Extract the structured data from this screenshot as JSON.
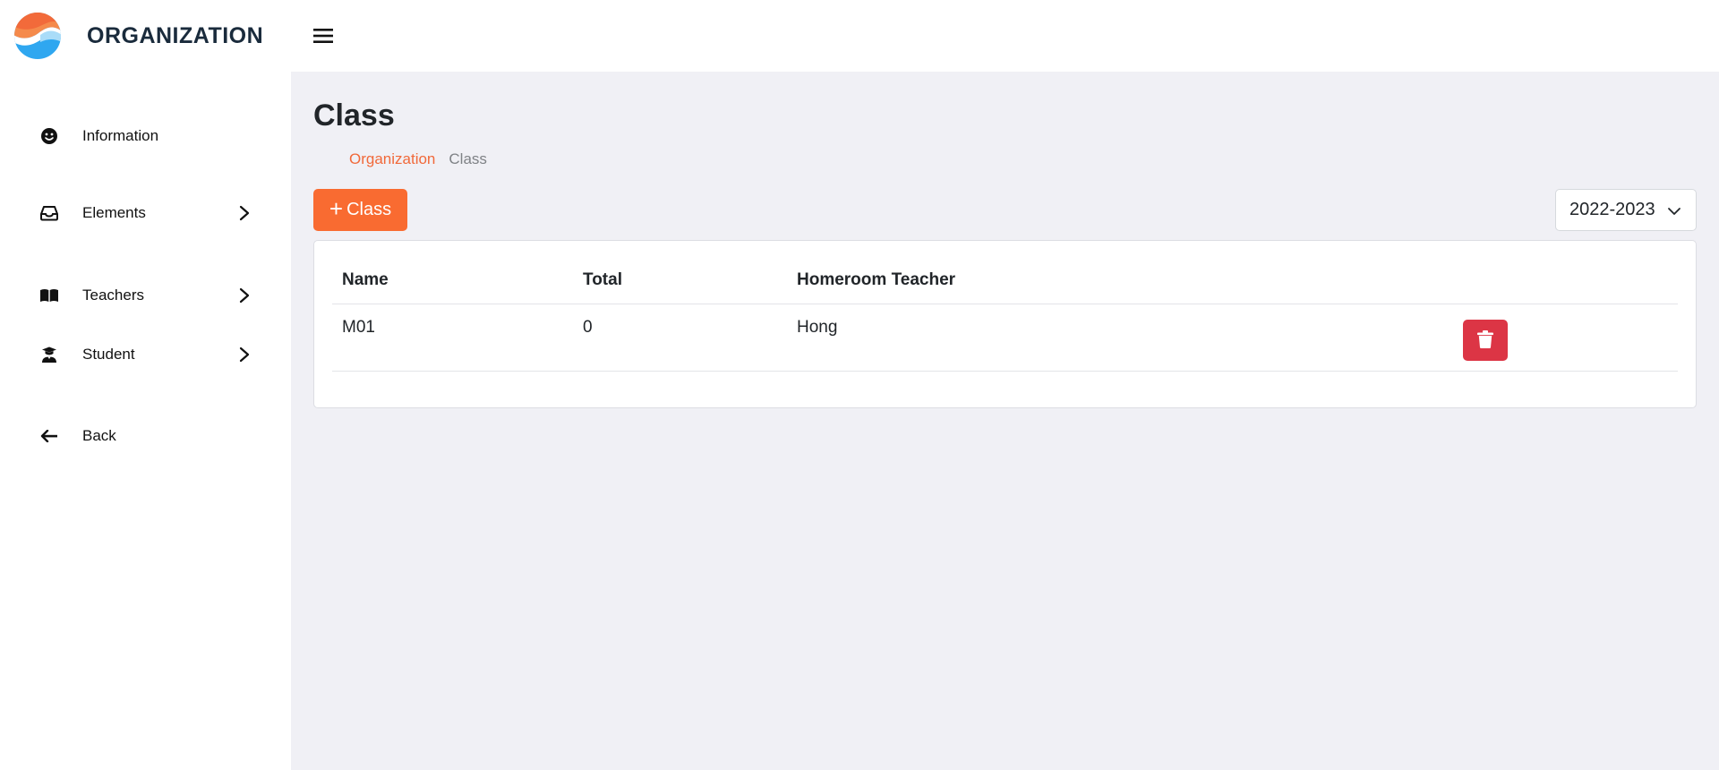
{
  "header": {
    "brand": "ORGANIZATION",
    "logo_icon": "wave-logo-icon",
    "menu_icon": "hamburger-icon"
  },
  "sidebar": {
    "items": [
      {
        "label": "Information",
        "icon": "smile-icon",
        "has_chevron": false
      },
      {
        "label": "Elements",
        "icon": "inbox-icon",
        "has_chevron": true
      },
      {
        "label": "Teachers",
        "icon": "book-icon",
        "has_chevron": true
      },
      {
        "label": "Student",
        "icon": "student-icon",
        "has_chevron": true
      },
      {
        "label": "Back",
        "icon": "arrow-left-icon",
        "has_chevron": false
      }
    ]
  },
  "main": {
    "title": "Class",
    "breadcrumb": {
      "parent": "Organization",
      "current": "Class"
    },
    "add_button": {
      "icon": "+",
      "label": "Class"
    },
    "year_select": {
      "value": "2022-2023"
    },
    "table": {
      "headers": [
        "Name",
        "Total",
        "Homeroom Teacher"
      ],
      "rows": [
        {
          "name": "M01",
          "total": "0",
          "teacher": "Hong"
        }
      ]
    }
  },
  "colors": {
    "accent": "#f96b31",
    "breadcrumb_link": "#f1693a",
    "danger": "#dc3545",
    "main_bg": "#f0f0f5"
  }
}
